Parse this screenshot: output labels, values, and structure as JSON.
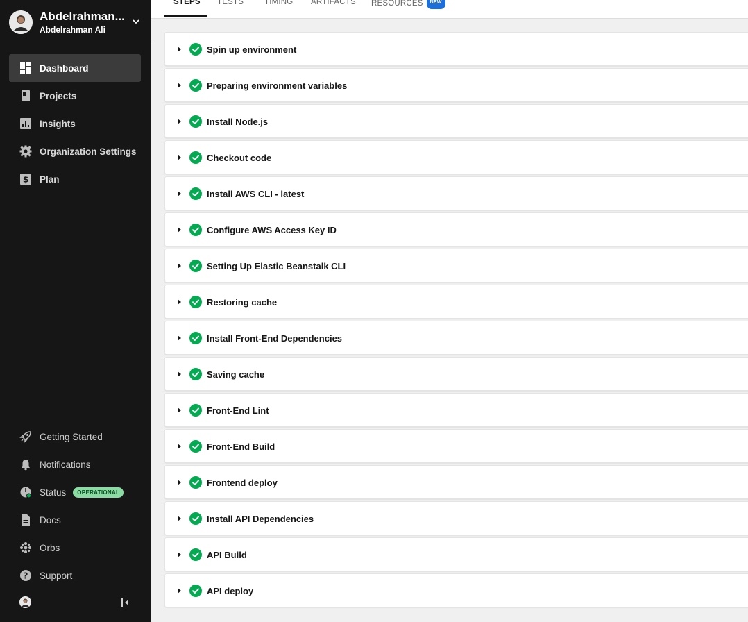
{
  "org": {
    "name": "Abdelrahman...",
    "user": "Abdelrahman Ali"
  },
  "nav": [
    {
      "label": "Dashboard",
      "icon": "dashboard-icon",
      "active": true
    },
    {
      "label": "Projects",
      "icon": "projects-icon",
      "active": false
    },
    {
      "label": "Insights",
      "icon": "insights-icon",
      "active": false
    },
    {
      "label": "Organization Settings",
      "icon": "gear-icon",
      "active": false
    },
    {
      "label": "Plan",
      "icon": "dollar-icon",
      "active": false
    }
  ],
  "bottom_nav": [
    {
      "label": "Getting Started",
      "icon": "rocket-icon"
    },
    {
      "label": "Notifications",
      "icon": "bell-icon"
    },
    {
      "label": "Status",
      "icon": "status-icon",
      "badge": "OPERATIONAL"
    },
    {
      "label": "Docs",
      "icon": "docs-icon"
    },
    {
      "label": "Orbs",
      "icon": "orbs-icon"
    },
    {
      "label": "Support",
      "icon": "help-icon"
    }
  ],
  "tabs": [
    {
      "label": "STEPS",
      "active": true
    },
    {
      "label": "TESTS",
      "active": false
    },
    {
      "label": "TIMING",
      "active": false
    },
    {
      "label": "ARTIFACTS",
      "active": false
    },
    {
      "label": "RESOURCES",
      "active": false,
      "badge": "NEW"
    }
  ],
  "steps": [
    {
      "label": "Spin up environment",
      "status": "success"
    },
    {
      "label": "Preparing environment variables",
      "status": "success"
    },
    {
      "label": "Install Node.js",
      "status": "success"
    },
    {
      "label": "Checkout code",
      "status": "success"
    },
    {
      "label": "Install AWS CLI - latest",
      "status": "success"
    },
    {
      "label": "Configure AWS Access Key ID",
      "status": "success"
    },
    {
      "label": "Setting Up Elastic Beanstalk CLI",
      "status": "success"
    },
    {
      "label": "Restoring cache",
      "status": "success"
    },
    {
      "label": "Install Front-End Dependencies",
      "status": "success"
    },
    {
      "label": "Saving cache",
      "status": "success"
    },
    {
      "label": "Front-End Lint",
      "status": "success"
    },
    {
      "label": "Front-End Build",
      "status": "success"
    },
    {
      "label": "Frontend deploy",
      "status": "success"
    },
    {
      "label": "Install API Dependencies",
      "status": "success"
    },
    {
      "label": "API Build",
      "status": "success"
    },
    {
      "label": "API deploy",
      "status": "success"
    }
  ],
  "colors": {
    "sidebar_bg": "#161616",
    "success": "#04aa51",
    "badge_blue": "#1a6fdc",
    "badge_green": "#8bdca3"
  }
}
